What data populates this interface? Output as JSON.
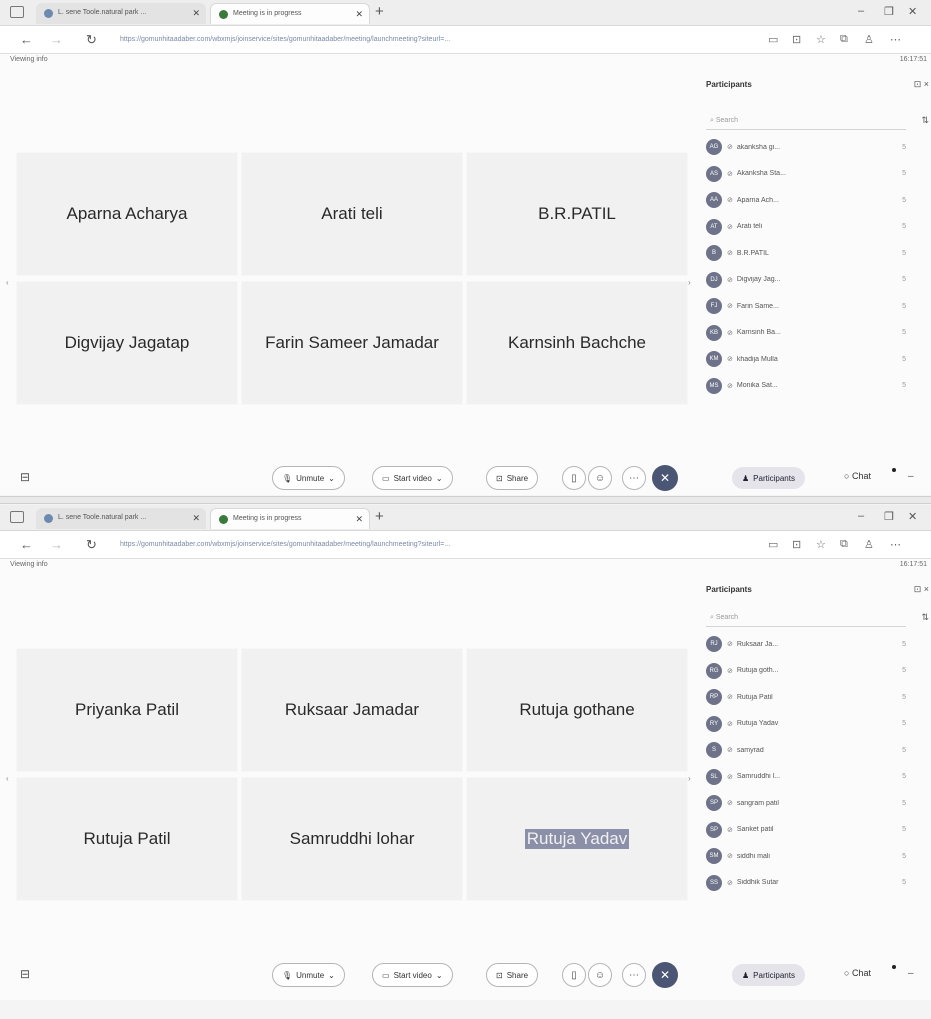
{
  "browser": {
    "tab1_title": "L. sene Toole.natural park ...",
    "tab2_title": "Meeting is in progress",
    "url": "https://gomunhitaadaber.com/wbxmjs/joinservice/sites/gomunhitaadaber/meeting/launchmeeting?siteurl=...",
    "viewing_info": "Viewing info",
    "clock": "16:17:51"
  },
  "screens": [
    {
      "tiles": [
        "Aparna Acharya",
        "Arati teli",
        "B.R.PATIL",
        "Digvijay Jagatap",
        "Farin Sameer Jamadar",
        "Karnsinh Bachche"
      ],
      "participants": [
        {
          "initials": "AG",
          "name": "akanksha gi...",
          "status": "5"
        },
        {
          "initials": "AS",
          "name": "Akanksha Sta...",
          "status": "5"
        },
        {
          "initials": "AA",
          "name": "Aparna Ach...",
          "status": "5"
        },
        {
          "initials": "AT",
          "name": "Arati teli",
          "status": "5"
        },
        {
          "initials": "B",
          "name": "B.R.PATIL",
          "status": "5"
        },
        {
          "initials": "DJ",
          "name": "Digvijay Jag...",
          "status": "5"
        },
        {
          "initials": "FJ",
          "name": "Farin Same...",
          "status": "5"
        },
        {
          "initials": "KB",
          "name": "Karnsinh Ba...",
          "status": "5"
        },
        {
          "initials": "KM",
          "name": "khadija Mulla",
          "status": "5"
        },
        {
          "initials": "MS",
          "name": "Monika Sat...",
          "status": "5"
        }
      ]
    },
    {
      "tiles": [
        "Priyanka Patil",
        "Ruksaar Jamadar",
        "Rutuja gothane",
        "Rutuja Patil",
        "Samruddhi lohar",
        "Rutuja Yadav"
      ],
      "participants": [
        {
          "initials": "RJ",
          "name": "Ruksaar Ja...",
          "status": "5"
        },
        {
          "initials": "RG",
          "name": "Rutuja goth...",
          "status": "5"
        },
        {
          "initials": "RP",
          "name": "Rutuja Patil",
          "status": "5"
        },
        {
          "initials": "RY",
          "name": "Rutuja Yadav",
          "status": "5"
        },
        {
          "initials": "S",
          "name": "samyrad",
          "status": "5"
        },
        {
          "initials": "SL",
          "name": "Samruddhi l...",
          "status": "5"
        },
        {
          "initials": "SP",
          "name": "sangram patil",
          "status": "5"
        },
        {
          "initials": "SP",
          "name": "Sanket patil",
          "status": "5"
        },
        {
          "initials": "SM",
          "name": "siddhi mali",
          "status": "5"
        },
        {
          "initials": "SS",
          "name": "Siddhik Sutar",
          "status": "5"
        }
      ]
    }
  ],
  "controls": {
    "unmute": "Unmute",
    "start_video": "Start video",
    "share": "Share",
    "participants": "Participants",
    "chat": "Chat"
  },
  "panel": {
    "title": "Participants",
    "search_placeholder": "Search"
  }
}
